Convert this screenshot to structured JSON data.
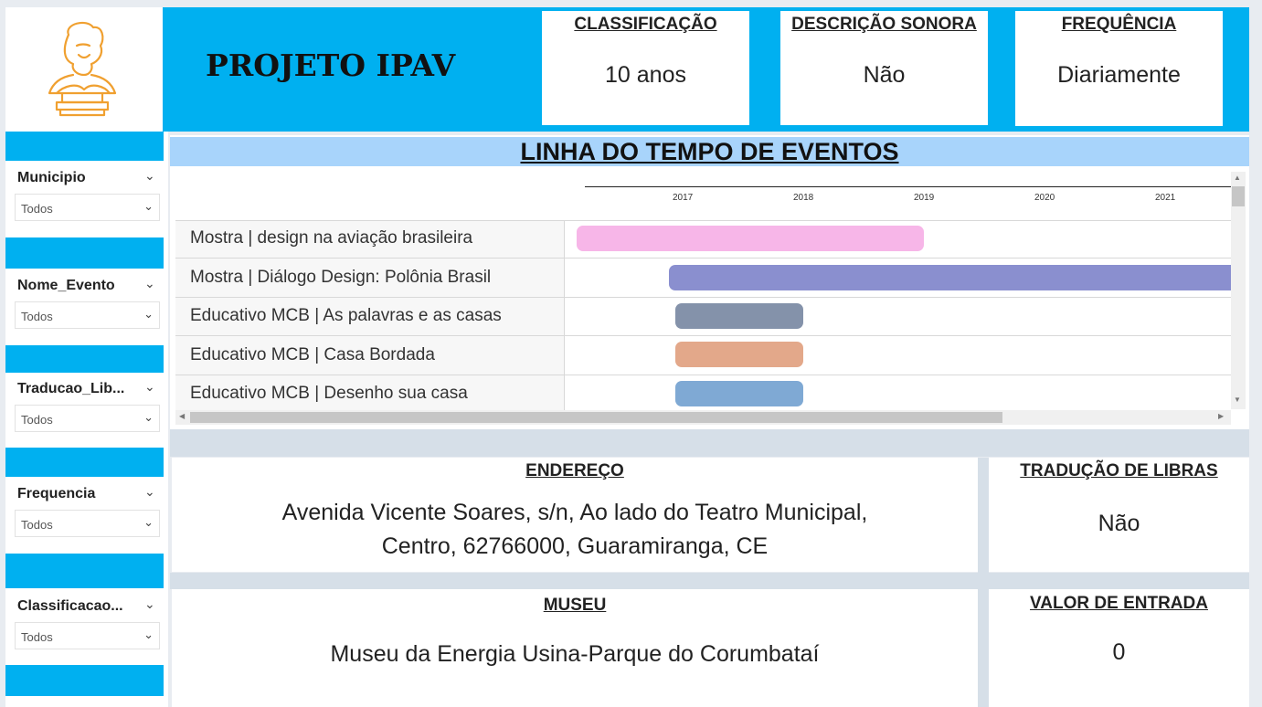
{
  "header": {
    "project_title": "PROJETO IPAV",
    "kpis": [
      {
        "title": "CLASSIFICAÇÃO",
        "value": "10 anos"
      },
      {
        "title": "DESCRIÇÃO SONORA",
        "value": "Não"
      },
      {
        "title": "FREQUÊNCIA",
        "value": "Diariamente"
      }
    ]
  },
  "filters": [
    {
      "label": "Municipio",
      "value": "Todos"
    },
    {
      "label": "Nome_Evento",
      "value": "Todos"
    },
    {
      "label": "Traducao_Lib...",
      "value": "Todos"
    },
    {
      "label": "Frequencia",
      "value": "Todos"
    },
    {
      "label": "Classificacao...",
      "value": "Todos"
    }
  ],
  "timeline": {
    "title": "LINHA DO TEMPO DE EVENTOS",
    "years": [
      "2017",
      "2018",
      "2019",
      "2020",
      "2021"
    ],
    "events": [
      {
        "name": "Mostra | design na aviação brasileira",
        "color": "#f7b6e8"
      },
      {
        "name": "Mostra | Diálogo Design: Polônia Brasil",
        "color": "#8a8fcf"
      },
      {
        "name": "Educativo MCB | As palavras e as casas",
        "color": "#8492aa"
      },
      {
        "name": "Educativo MCB | Casa Bordada",
        "color": "#e3a88a"
      },
      {
        "name": "Educativo MCB | Desenho sua casa",
        "color": "#7fa9d4"
      }
    ]
  },
  "details": {
    "endereco_title": "ENDEREÇO",
    "endereco_line1": "Avenida Vicente Soares, s/n, Ao lado do Teatro Municipal,",
    "endereco_line2": "Centro, 62766000, Guaramiranga, CE",
    "libras_title": "TRADUÇÃO DE LIBRAS",
    "libras_value": "Não",
    "museu_title": "MUSEU",
    "museu_value": "Museu da Energia Usina-Parque do Corumbataí",
    "entrada_title": "VALOR DE ENTRADA",
    "entrada_value": "0"
  }
}
